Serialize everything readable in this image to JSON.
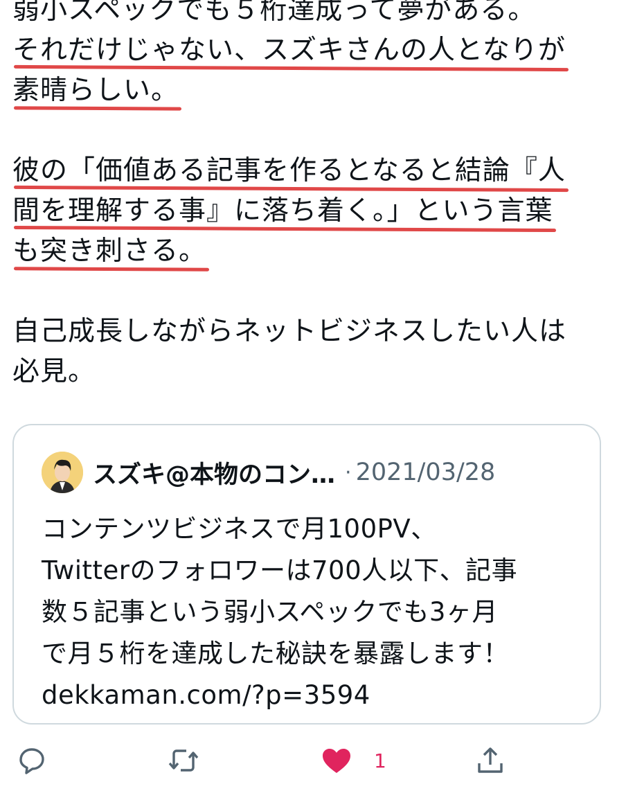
{
  "tweet": {
    "lines": [
      "弱小スペックでも５桁達成って夢がある。",
      "それだけじゃない、スズキさんの人となりが",
      "素晴らしい。",
      "彼の「価値ある記事を作るとなると結論『人",
      "間を理解する事』に落ち着く。」という言葉",
      "も突き刺さる。",
      "自己成長しながらネットビジネスしたい人は",
      "必見。"
    ]
  },
  "quote": {
    "author": "スズキ@本物のコン…",
    "separator": "·",
    "date": "2021/03/28",
    "body_lines": [
      "コンテンツビジネスで月100PV、",
      "Twitterのフォロワーは700人以下、記事",
      "数５記事という弱小スペックでも3ヶ月",
      "で月５桁を達成した秘訣を暴露します！",
      "dekkaman.com/?p=3594"
    ]
  },
  "actions": {
    "reply_icon": "reply-icon",
    "retweet_icon": "retweet-icon",
    "like_icon": "heart-icon",
    "like_count": "1",
    "share_icon": "share-icon"
  },
  "colors": {
    "underline": "#e04848",
    "like": "#e0245e",
    "muted": "#536471",
    "border": "#cfd9de"
  }
}
